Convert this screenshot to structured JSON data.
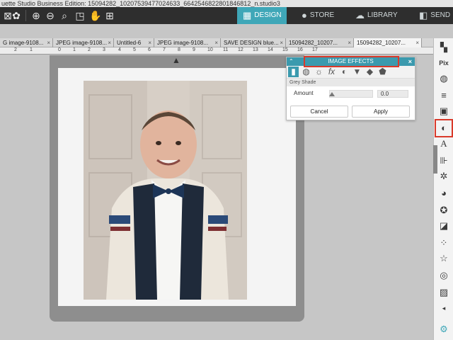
{
  "window": {
    "title": "uette Studio Business Edition: 15094282_10207539477024633_6642546822801846812_n.studio3"
  },
  "toolbar": {
    "icons": [
      "select-all-icon",
      "zoom-in-icon",
      "zoom-out-icon",
      "zoom-fit-icon",
      "pan-icon",
      "add-page-icon"
    ],
    "tabs": [
      {
        "label": "DESIGN",
        "icon": "grid-icon",
        "active": true
      },
      {
        "label": "STORE",
        "icon": "store-icon",
        "active": false
      },
      {
        "label": "LIBRARY",
        "icon": "cloud-icon",
        "active": false
      },
      {
        "label": "SEND",
        "icon": "send-icon",
        "active": false
      }
    ]
  },
  "doc_tabs": [
    {
      "label": "G image-9108...",
      "active": false
    },
    {
      "label": "JPEG image-9108...",
      "active": false
    },
    {
      "label": "Untitled-6",
      "active": false
    },
    {
      "label": "JPEG image-9108...",
      "active": false
    },
    {
      "label": "SAVE DESIGN blue...",
      "active": false
    },
    {
      "label": "15094282_10207...",
      "active": false
    },
    {
      "label": "15094282_10207...",
      "active": true
    }
  ],
  "ruler": {
    "numbers": [
      "2",
      "1",
      "0",
      "1",
      "2",
      "3",
      "4",
      "5",
      "6",
      "7",
      "8",
      "9",
      "10",
      "11",
      "12",
      "13",
      "14",
      "15",
      "16",
      "17"
    ]
  },
  "canvas": {
    "photo_alt": "Photo of a young boy in a cardigan and bow tie"
  },
  "image_effects_panel": {
    "title": "IMAGE EFFECTS",
    "section": "Grey Shade",
    "amount_label": "Amount",
    "amount_value": "0.0",
    "amount_level": 0,
    "cancel_label": "Cancel",
    "apply_label": "Apply",
    "effect_icons": [
      "grey-shade-icon",
      "palette-icon",
      "brightness-icon",
      "fx-icon",
      "contrast-icon",
      "filter-icon",
      "tint-icon",
      "shape-icon"
    ]
  },
  "sidebar": {
    "icons": [
      "page-setup-icon",
      "pixscan-icon",
      "fill-color-icon",
      "line-style-icon",
      "image-effects-icon-a",
      "image-effects-icon",
      "text-style-icon",
      "align-icon",
      "trace-icon",
      "offset-icon",
      "star-icon",
      "sketch-icon",
      "rhinestone-icon",
      "star-outline-icon",
      "spiral-icon",
      "settings-icon"
    ]
  },
  "colors": {
    "accent": "#3fa7b8",
    "highlight_box": "#d93a2b",
    "toolbar_bg": "#2e2e2e"
  }
}
